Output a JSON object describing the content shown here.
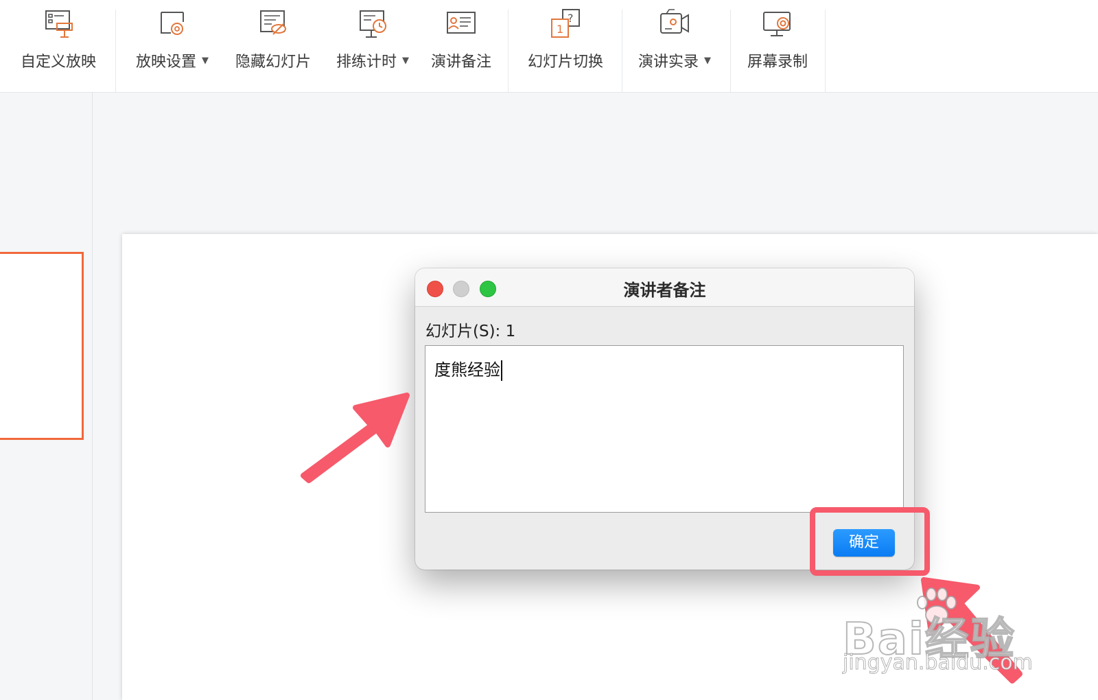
{
  "toolbar": {
    "items": [
      {
        "label": "自定义放映",
        "icon": "custom-show-icon",
        "dropdown": false
      },
      {
        "label": "放映设置",
        "icon": "slideshow-settings-icon",
        "dropdown": true
      },
      {
        "label": "隐藏幻灯片",
        "icon": "hide-slide-icon",
        "dropdown": false
      },
      {
        "label": "排练计时",
        "icon": "rehearse-timing-icon",
        "dropdown": true
      },
      {
        "label": "演讲备注",
        "icon": "speaker-notes-icon",
        "dropdown": false
      },
      {
        "label": "幻灯片切换",
        "icon": "slide-switch-icon",
        "dropdown": false
      },
      {
        "label": "演讲实录",
        "icon": "record-video-icon",
        "dropdown": true
      },
      {
        "label": "屏幕录制",
        "icon": "screen-record-icon",
        "dropdown": false
      }
    ],
    "icon_color": "#e2763b",
    "caret": "▼"
  },
  "dialog": {
    "title": "演讲者备注",
    "slide_label": "幻灯片(S): 1",
    "notes_text": "度熊经验",
    "ok_label": "确定"
  },
  "watermark": {
    "main": "Bai经验",
    "sub": "jingyan.baidu.com"
  },
  "colors": {
    "accent_orange": "#f0683a",
    "annotation_pink": "#f65a6b",
    "ok_blue": "#0a7cf3"
  }
}
